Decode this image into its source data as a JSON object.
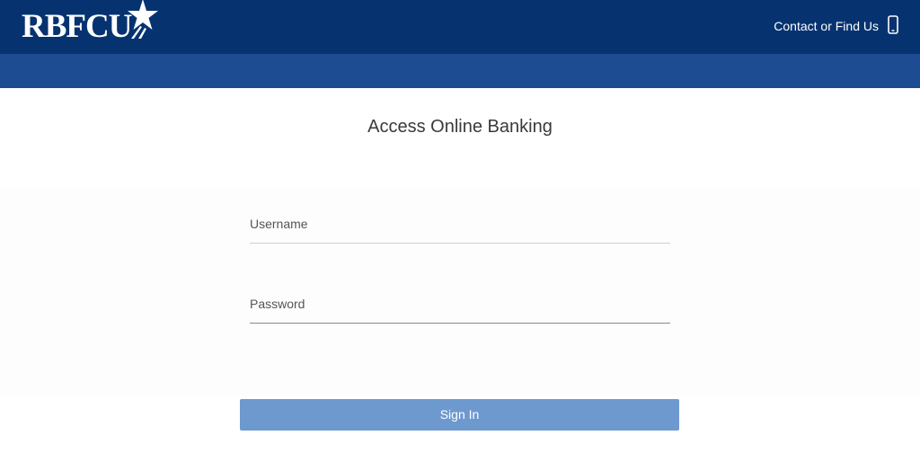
{
  "header": {
    "logo_text": "RBFCU",
    "contact_label": "Contact or Find Us"
  },
  "main": {
    "title": "Access Online Banking",
    "username": {
      "placeholder": "Username",
      "value": ""
    },
    "password": {
      "placeholder": "Password",
      "value": ""
    },
    "signin_label": "Sign In"
  },
  "colors": {
    "topbar": "#063370",
    "subbar": "#1d4c92",
    "button": "#6e99cf"
  },
  "icons": {
    "logo_star": "star-icon",
    "contact": "mobile-phone-icon"
  }
}
